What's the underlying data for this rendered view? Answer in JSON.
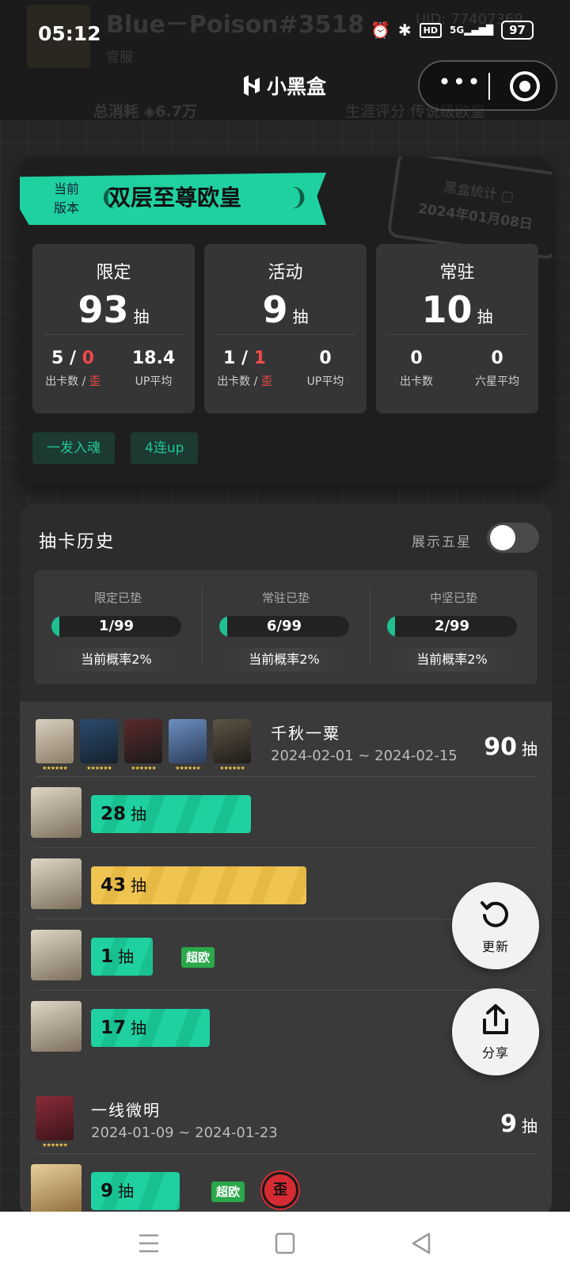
{
  "header": {
    "ghost_name": "Blue－Poison#3518",
    "ghost_uid": "UID: 77407369",
    "ghost_sub": "官服",
    "ghost_consume_label": "总消耗",
    "ghost_consume_value": "6.7万",
    "ghost_rating_label": "生涯评分 传说级欧皇"
  },
  "status_bar": {
    "time": "05:12",
    "network": "5G",
    "hd": "HD",
    "battery": "97"
  },
  "app": {
    "title": "小黑盒",
    "more_icon": "more-dots-icon",
    "close_icon": "target-close-icon"
  },
  "summary": {
    "ribbon_small": "当前版本",
    "ribbon_title": "双层至尊欧皇",
    "stamp_line1": "黑盒统计 ▢",
    "stamp_line2": "2024年01月08日",
    "boxes": [
      {
        "label": "限定",
        "count": "93",
        "unit": "抽",
        "left_val_a": "5 / ",
        "left_val_b": "0",
        "left_lbl_a": "出卡数 / ",
        "left_lbl_b": "歪",
        "right_val": "18.4",
        "right_lbl": "UP平均"
      },
      {
        "label": "活动",
        "count": "9",
        "unit": "抽",
        "left_val_a": "1 / ",
        "left_val_b": "1",
        "left_lbl_a": "出卡数 / ",
        "left_lbl_b": "歪",
        "right_val": "0",
        "right_lbl": "UP平均"
      },
      {
        "label": "常驻",
        "count": "10",
        "unit": "抽",
        "left_val_a": "0",
        "left_val_b": "",
        "left_lbl_a": "出卡数",
        "left_lbl_b": "",
        "right_val": "0",
        "right_lbl": "六星平均"
      }
    ],
    "tags": [
      "一发入魂",
      "4连up"
    ]
  },
  "history": {
    "title": "抽卡历史",
    "toggle_label": "展示五星",
    "toggle_on": false,
    "pity": [
      {
        "title": "限定已垫",
        "value": "1/99",
        "fill": 0.0101,
        "rate": "当前概率2%"
      },
      {
        "title": "常驻已垫",
        "value": "6/99",
        "fill": 0.0606,
        "rate": "当前概率2%"
      },
      {
        "title": "中坚已垫",
        "value": "2/99",
        "fill": 0.0202,
        "rate": "当前概率2%"
      }
    ],
    "banners": [
      {
        "name": "千秋一粟",
        "date": "2024-02-01 ~ 2024-02-15",
        "total": "90",
        "unit": "抽",
        "pulls": [
          {
            "count": "28",
            "unit": "抽",
            "color": "green",
            "fraction": 0.28
          },
          {
            "count": "43",
            "unit": "抽",
            "color": "yellow",
            "fraction": 0.43
          },
          {
            "count": "1",
            "unit": "抽",
            "color": "green",
            "fraction": 0.01,
            "badge": "超欧"
          },
          {
            "count": "17",
            "unit": "抽",
            "color": "green",
            "fraction": 0.17
          }
        ]
      },
      {
        "name": "一线微明",
        "date": "2024-01-09 ~ 2024-01-23",
        "total": "9",
        "unit": "抽",
        "pulls": [
          {
            "count": "9",
            "unit": "抽",
            "color": "green",
            "fraction": 0.09,
            "badge": "超欧",
            "badge2": "歪"
          }
        ]
      }
    ]
  },
  "fabs": {
    "refresh": "更新",
    "share": "分享"
  },
  "nav": {
    "menu_icon": "menu-icon",
    "home_icon": "home-square-icon",
    "back_icon": "back-triangle-icon"
  }
}
